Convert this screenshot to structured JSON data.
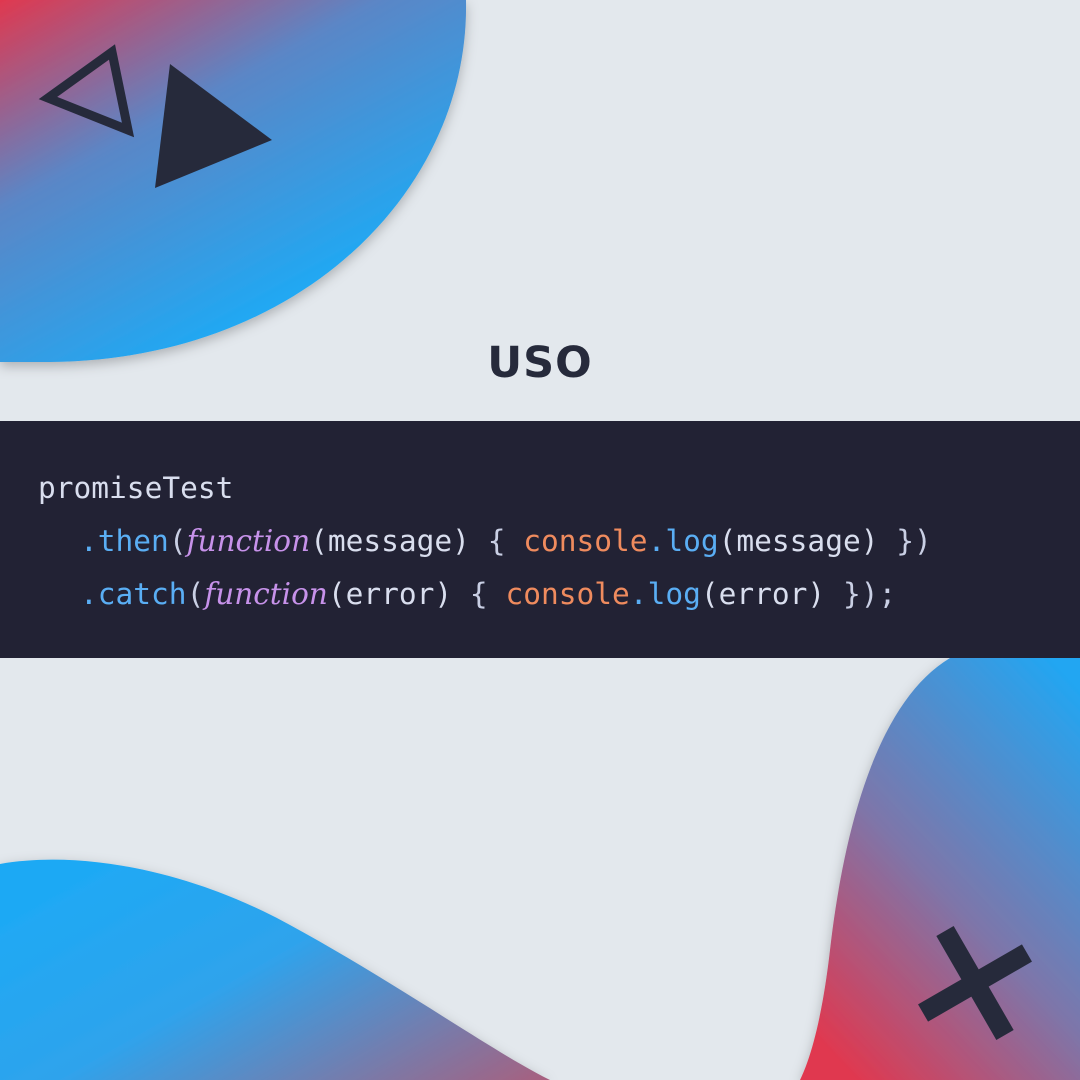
{
  "heading": "USO",
  "code": {
    "line1": {
      "object": "promiseTest"
    },
    "line2": {
      "dot_method": ".then",
      "open_paren": "(",
      "keyword": "function",
      "params": "(message)",
      "brace_open": " { ",
      "console": "console",
      "dot": ".",
      "log": "log",
      "args": "(message)",
      "tail": " })"
    },
    "line3": {
      "dot_method": ".catch",
      "open_paren": "(",
      "keyword": "function",
      "params": "(error)",
      "brace_open": " { ",
      "console": "console",
      "dot": ".",
      "log": "log",
      "args": "(error)",
      "tail": " });"
    }
  },
  "decorations": {
    "gradient_red": "#e0384f",
    "gradient_blue": "#1fa9f4",
    "shape_color": "#262a3b",
    "shapes": [
      "triangle-outline-icon",
      "play-triangle-icon",
      "cross-icon"
    ]
  },
  "colors": {
    "background": "#e3e8ed",
    "code_background": "#222234",
    "keyword": "#c792ea",
    "method": "#5aaef4",
    "object": "#ef8b5e",
    "text": "#d9deee"
  }
}
